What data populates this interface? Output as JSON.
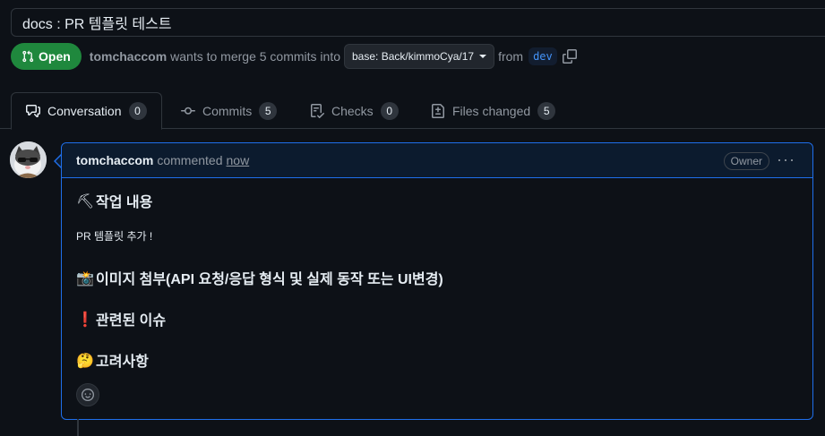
{
  "pr": {
    "title": "docs : PR 템플릿 테스트",
    "state": "Open",
    "author": "tomchaccom",
    "merge_text": "wants to merge 5 commits into",
    "base_branch": "base: Back/kimmoCya/17",
    "from_text": "from",
    "head_branch": "dev"
  },
  "tabs": [
    {
      "label": "Conversation",
      "count": "0",
      "icon": "comment-discussion-icon"
    },
    {
      "label": "Commits",
      "count": "5",
      "icon": "git-commit-icon"
    },
    {
      "label": "Checks",
      "count": "0",
      "icon": "checklist-icon"
    },
    {
      "label": "Files changed",
      "count": "5",
      "icon": "file-diff-icon"
    }
  ],
  "comment": {
    "author": "tomchaccom",
    "action": "commented",
    "time": "now",
    "badge": "Owner",
    "sections": [
      {
        "emoji": "⛏",
        "heading": "작업 내용"
      },
      {
        "text": "PR 템플릿 추가 !"
      },
      {
        "emoji": "📸",
        "heading": "이미지 첨부(API 요청/응답 형식 및 실제 동작 또는 UI변경)"
      },
      {
        "emoji": "❗",
        "heading": "관련된 이슈"
      },
      {
        "emoji": "🤔",
        "heading": "고려사항"
      }
    ]
  },
  "colors": {
    "open_green": "#1f883d",
    "accent_blue": "#1f6feb",
    "background": "#0d1117"
  }
}
